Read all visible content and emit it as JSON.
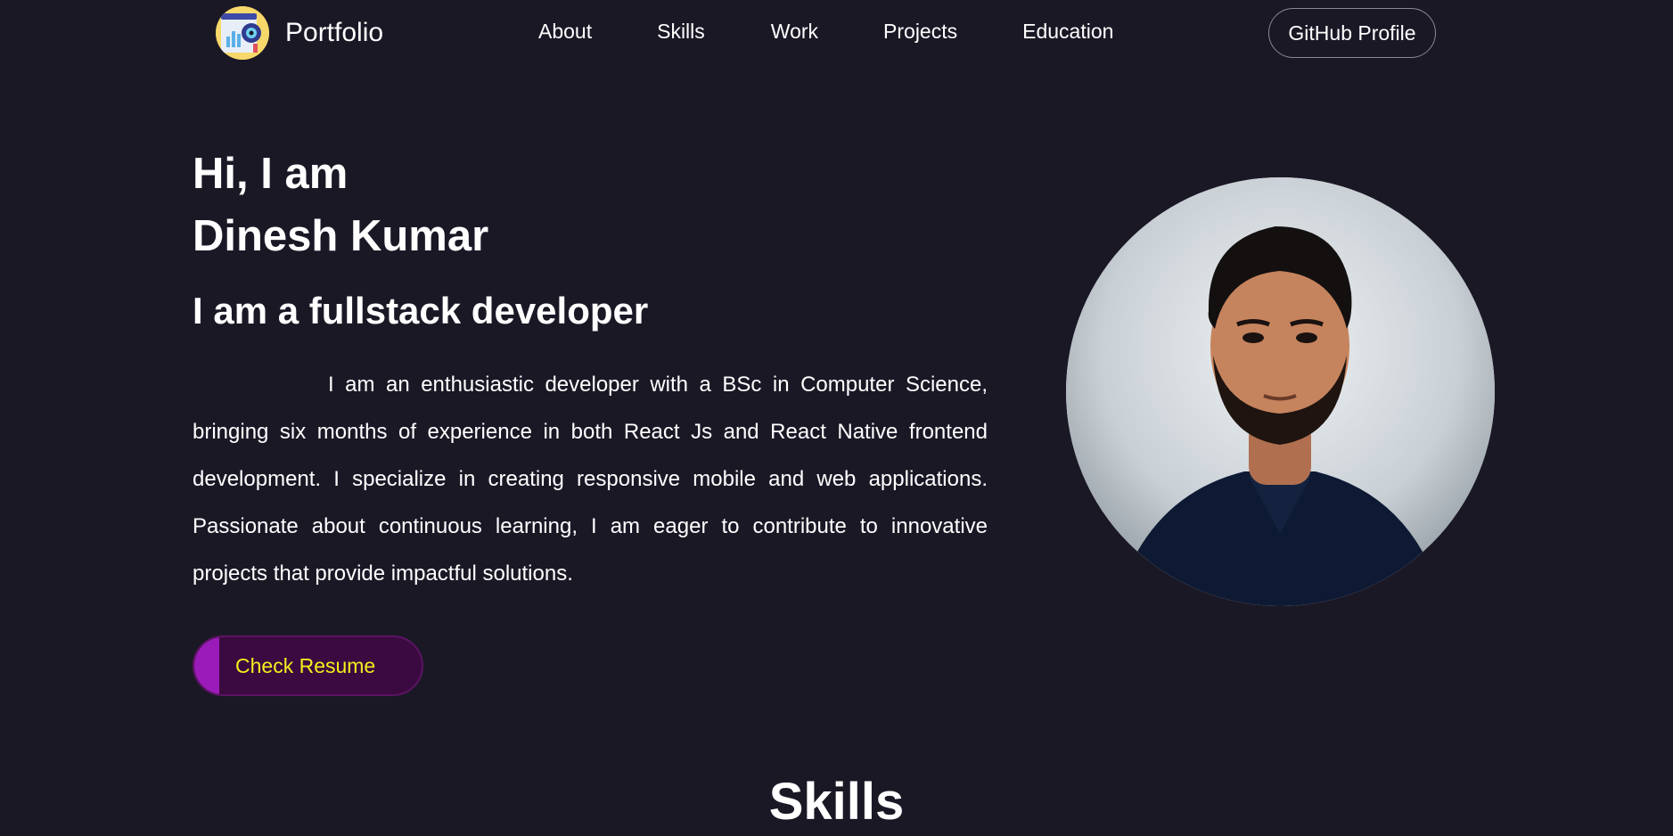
{
  "nav": {
    "logo_text": "Portfolio",
    "links": [
      "About",
      "Skills",
      "Work",
      "Projects",
      "Education"
    ],
    "github_label": "GitHub Profile"
  },
  "hero": {
    "greeting_line1": "Hi, I am",
    "name": "Dinesh Kumar",
    "role": "I am a fullstack developer",
    "bio": "I am an enthusiastic developer with a BSc in Computer Science, bringing six months of experience in both React Js and React Native frontend development. I specialize in creating responsive mobile and web applications. Passionate about continuous learning, I am eager to contribute to innovative projects that provide impactful solutions.",
    "resume_label": "Check Resume"
  },
  "skills": {
    "heading": "Skills"
  },
  "colors": {
    "background": "#1b1826",
    "resume_text": "#f3ef1d",
    "resume_accent": "#9b1bb8",
    "resume_bg": "#3b0a40"
  },
  "icons": {
    "logo": "portfolio-logo-icon",
    "avatar": "profile-photo"
  }
}
